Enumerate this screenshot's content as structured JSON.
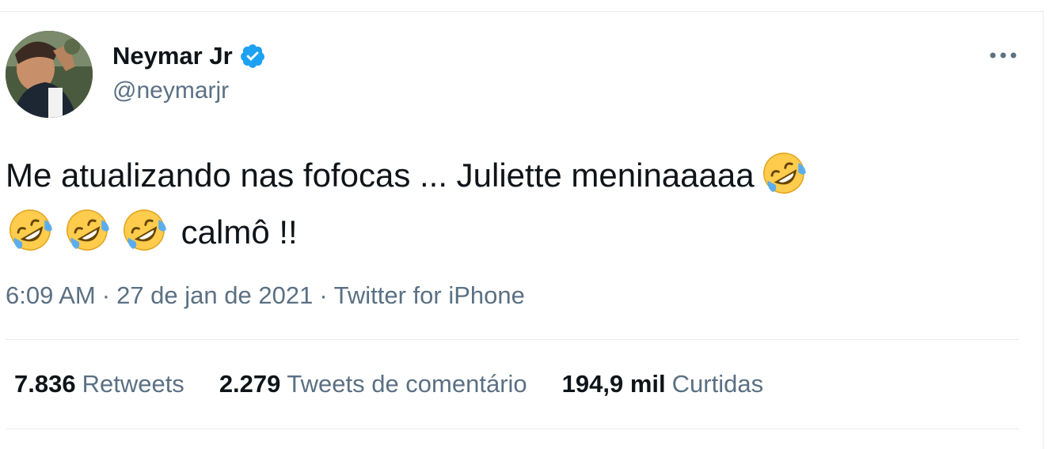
{
  "author": {
    "name": "Neymar Jr",
    "handle": "@neymarjr"
  },
  "tweet": {
    "text_line1": "Me atualizando nas fofocas ... Juliette meninaaaaa",
    "text_line2": "calmô !!",
    "emoji": "rolling-on-floor-laughing-icon"
  },
  "meta": {
    "time": "6:09 AM",
    "separator": "·",
    "date": "27 de jan de 2021",
    "source": "Twitter for iPhone"
  },
  "stats": {
    "retweets_count": "7.836",
    "retweets_label": "Retweets",
    "quotes_count": "2.279",
    "quotes_label": "Tweets de comentário",
    "likes_count": "194,9 mil",
    "likes_label": "Curtidas"
  },
  "colors": {
    "verified": "#1da1f2",
    "secondary_text": "#5b7083",
    "primary_text": "#0f1419",
    "divider": "#e6ecf0"
  }
}
